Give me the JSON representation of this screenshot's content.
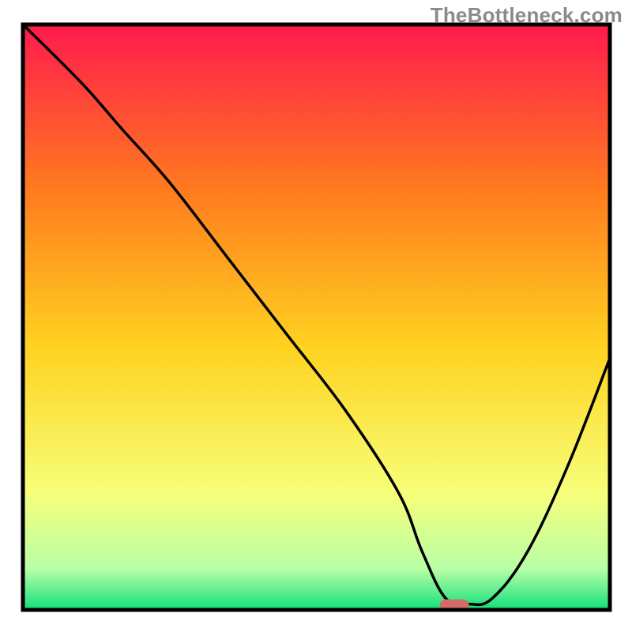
{
  "watermark": "TheBottleneck.com",
  "chart_data": {
    "type": "line",
    "title": "",
    "xlabel": "",
    "ylabel": "",
    "xlim": [
      0,
      100
    ],
    "ylim": [
      0,
      100
    ],
    "background_gradient": {
      "top": "#ff1a4d",
      "upper_mid": "#ff7a1f",
      "mid": "#ffd21f",
      "lower_mid": "#f7ff7a",
      "near_bottom": "#b8ffa6",
      "bottom": "#11e07a"
    },
    "curve": {
      "x": [
        0,
        10,
        17,
        25,
        35,
        45,
        55,
        64,
        68,
        72,
        76,
        80,
        86,
        93,
        100
      ],
      "y": [
        100,
        90,
        82,
        73,
        60,
        47,
        34,
        20,
        10,
        2,
        1,
        2,
        10,
        25,
        43
      ]
    },
    "marker": {
      "x": 73.5,
      "y": 0.8,
      "width": 5.0,
      "height": 2.0,
      "color": "#d46a6a"
    },
    "frame": {
      "stroke": "#000000",
      "stroke_width": 5
    }
  }
}
